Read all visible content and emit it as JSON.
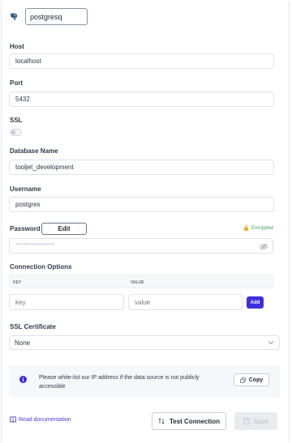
{
  "datasource": {
    "name_value": "postgresq",
    "icon": "postgresql-elephant-icon"
  },
  "host": {
    "label": "Host",
    "value": "localhost"
  },
  "port": {
    "label": "Port",
    "value": "5432"
  },
  "ssl": {
    "label": "SSL",
    "enabled": false
  },
  "database": {
    "label": "Database Name",
    "value": "tooljet_development"
  },
  "username": {
    "label": "Username",
    "value": "postgres"
  },
  "password": {
    "label": "Password",
    "edit_label": "Edit",
    "encrypted_label": "Encrypted",
    "masked_value": "***************"
  },
  "connection_options": {
    "label": "Connection Options",
    "key_header": "KEY",
    "value_header": "VALUE",
    "key_placeholder": "key",
    "value_placeholder": "value",
    "add_label": "Add"
  },
  "ssl_certificate": {
    "label": "SSL Certificate",
    "selected": "None"
  },
  "notice": {
    "text": "Please white-list our IP address if the data source is not publicly accessible",
    "copy_label": "Copy"
  },
  "footer": {
    "read_docs": "Read documentation",
    "test_connection": "Test Connection",
    "save": "Save"
  },
  "colors": {
    "primary": "#3e2fdc",
    "encrypted_green": "#3f9c4f",
    "link_purple": "#4c3ccf"
  }
}
